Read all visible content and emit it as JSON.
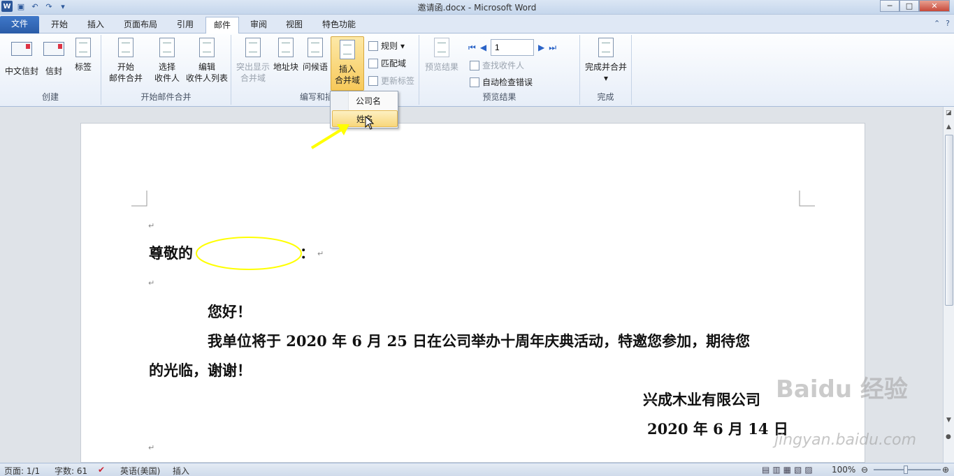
{
  "window": {
    "title": "邀请函.docx - Microsoft Word"
  },
  "tabs": [
    {
      "label": "文件"
    },
    {
      "label": "开始"
    },
    {
      "label": "插入"
    },
    {
      "label": "页面布局"
    },
    {
      "label": "引用"
    },
    {
      "label": "邮件"
    },
    {
      "label": "审阅"
    },
    {
      "label": "视图"
    },
    {
      "label": "特色功能"
    }
  ],
  "ribbon": {
    "create": {
      "label": "创建",
      "chinese_env": "中文信封",
      "envelope": "信封",
      "labels": "标签"
    },
    "start_merge": {
      "label": "开始邮件合并",
      "start_l1": "开始",
      "start_l2": "邮件合并",
      "select_l1": "选择",
      "select_l2": "收件人",
      "edit_l1": "编辑",
      "edit_l2": "收件人列表"
    },
    "write_insert": {
      "label": "编写和插",
      "highlight_l1": "突出显示",
      "highlight_l2": "合并域",
      "address": "地址块",
      "greeting": "问候语",
      "insert_l1": "插入",
      "insert_l2": "合并域",
      "rules": "规则",
      "match": "匹配域",
      "update": "更新标签"
    },
    "preview": {
      "label": "预览结果",
      "preview_results": "预览结果",
      "record": "1",
      "find": "查找收件人",
      "auto_check": "自动检查错误"
    },
    "finish": {
      "label": "完成",
      "finish_merge": "完成并合并"
    }
  },
  "dropdown": {
    "items": [
      {
        "label": "公司名"
      },
      {
        "label": "姓名"
      }
    ]
  },
  "document": {
    "greeting": "尊敬的",
    "colon": "：",
    "hello": "您好！",
    "body_line1": "我单位将于 2020 年 6 月 25 日在公司举办十周年庆典活动，特邀您参加，期待您",
    "body_line2": "的光临，谢谢！",
    "company": "兴成木业有限公司",
    "date": "2020 年 6 月 14 日"
  },
  "status": {
    "page": "页面: 1/1",
    "words": "字数: 61",
    "language": "英语(美国)",
    "mode": "插入",
    "zoom": "100%"
  },
  "watermark": {
    "brand": "Baidu 经验",
    "url": "jingyan.baidu.com"
  },
  "colors": {
    "accent": "#2b579a",
    "highlight": "#f8d77c",
    "annotation": "#ffff00"
  }
}
